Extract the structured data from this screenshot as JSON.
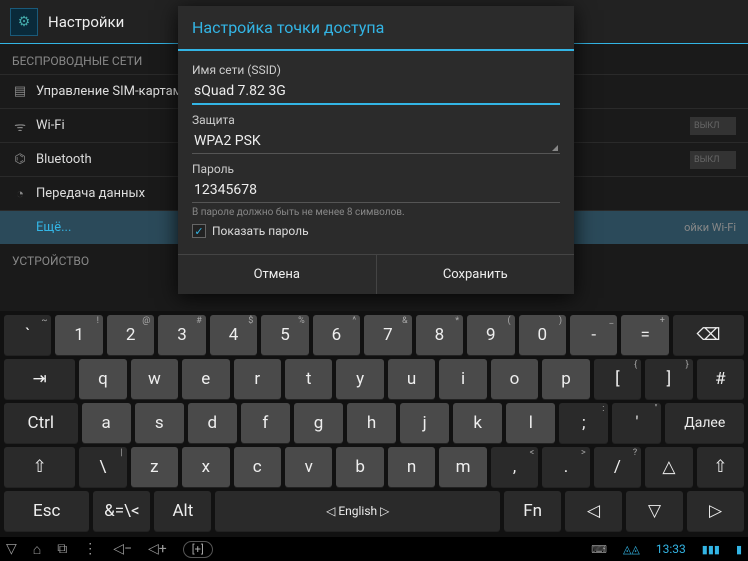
{
  "bg": {
    "title": "Настройки",
    "section_wireless": "БЕСПРОВОДНЫЕ СЕТИ",
    "sim": "Управление SIM-картам",
    "wifi": "Wi-Fi",
    "wifi_toggle": "ВЫКЛ",
    "bt": "Bluetooth",
    "bt_toggle": "ВЫКЛ",
    "data": "Передача данных",
    "more": "Ещё...",
    "section_device": "УСТРОЙСТВО",
    "right_hint": "ойки Wi-Fi"
  },
  "dialog": {
    "title": "Настройка точки доступа",
    "ssid_label": "Имя сети (SSID)",
    "ssid_value": "sQuad 7.82 3G",
    "security_label": "Защита",
    "security_value": "WPA2 PSK",
    "password_label": "Пароль",
    "password_value": "12345678",
    "hint": "В пароле должно быть не менее 8 символов.",
    "show_password": "Показать пароль",
    "cancel": "Отмена",
    "save": "Сохранить"
  },
  "keyboard": {
    "row1": [
      "`",
      "1",
      "2",
      "3",
      "4",
      "5",
      "6",
      "7",
      "8",
      "9",
      "0",
      "-",
      "="
    ],
    "row1_sup": [
      "~",
      "!",
      "@",
      "#",
      "$",
      "%",
      "^",
      "&",
      "*",
      "(",
      ")",
      "_",
      "+"
    ],
    "row2": [
      "q",
      "w",
      "e",
      "r",
      "t",
      "y",
      "u",
      "i",
      "o",
      "p",
      "[",
      "]",
      "#"
    ],
    "row2_sup": [
      "",
      "",
      "",
      "",
      "",
      "",
      "",
      "",
      "",
      "",
      "{",
      "}",
      ""
    ],
    "row3": [
      "a",
      "s",
      "d",
      "f",
      "g",
      "h",
      "j",
      "k",
      "l",
      ";",
      "'"
    ],
    "row3_sup": [
      "",
      "",
      "",
      "",
      "",
      "",
      "",
      "",
      "",
      ":",
      "\""
    ],
    "row4": [
      "\\",
      "z",
      "x",
      "c",
      "v",
      "b",
      "n",
      "m",
      ",",
      ".",
      "/"
    ],
    "row4_sup": [
      "|",
      "",
      "",
      "",
      "",
      "",
      "",
      "",
      "<",
      ">",
      "?"
    ],
    "ctrl": "Ctrl",
    "next": "Далее",
    "shift": "⇧",
    "up": "△",
    "esc": "Esc",
    "sym": "&=\\<",
    "alt": "Alt",
    "lang": "English",
    "fn": "Fn",
    "left": "◁",
    "down": "▽",
    "right": "▷",
    "backspace": "⌫",
    "tab": "⇥"
  },
  "nav": {
    "time": "13:33"
  }
}
